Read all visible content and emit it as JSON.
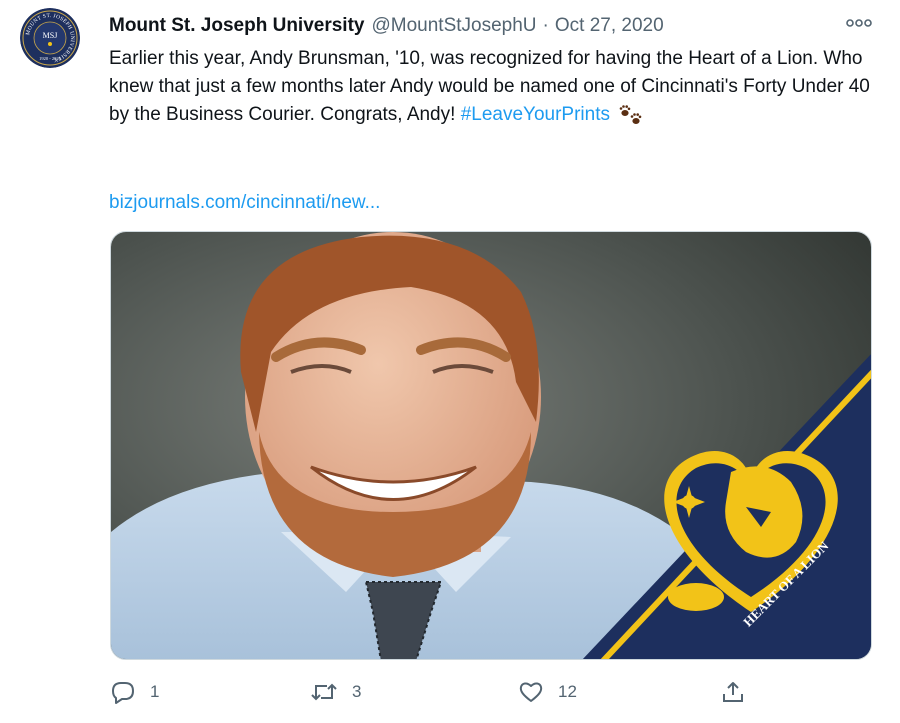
{
  "author": {
    "name": "Mount St. Joseph University",
    "handle": "@MountStJosephU",
    "separator": "·",
    "date": "Oct 27, 2020",
    "avatar_text": {
      "ring": "MOUNT ST. JOSEPH UNIVERSITY",
      "monogram": "MSJ",
      "years": "1920 - 2020"
    }
  },
  "tweet": {
    "text": "Earlier this year, Andy Brunsman, '10, was recognized for having the Heart of a Lion. Who knew that just a few months later Andy would be named one of Cincinnati's Forty Under 40 by the Business Courier. Congrats, Andy!",
    "hashtag": "#LeaveYourPrints",
    "link": "bizjournals.com/cincinnati/new..."
  },
  "media": {
    "badge_text": "HEART OF A LION"
  },
  "actions": {
    "replies": "1",
    "retweets": "3",
    "likes": "12"
  },
  "colors": {
    "link": "#1d9bf0",
    "muted": "#536471",
    "navy": "#1d2f5e",
    "gold": "#f2c318"
  },
  "icons": {
    "more": "more-icon",
    "paw": "paw-prints-icon",
    "reply": "reply-icon",
    "retweet": "retweet-icon",
    "like": "heart-icon",
    "share": "share-icon"
  }
}
